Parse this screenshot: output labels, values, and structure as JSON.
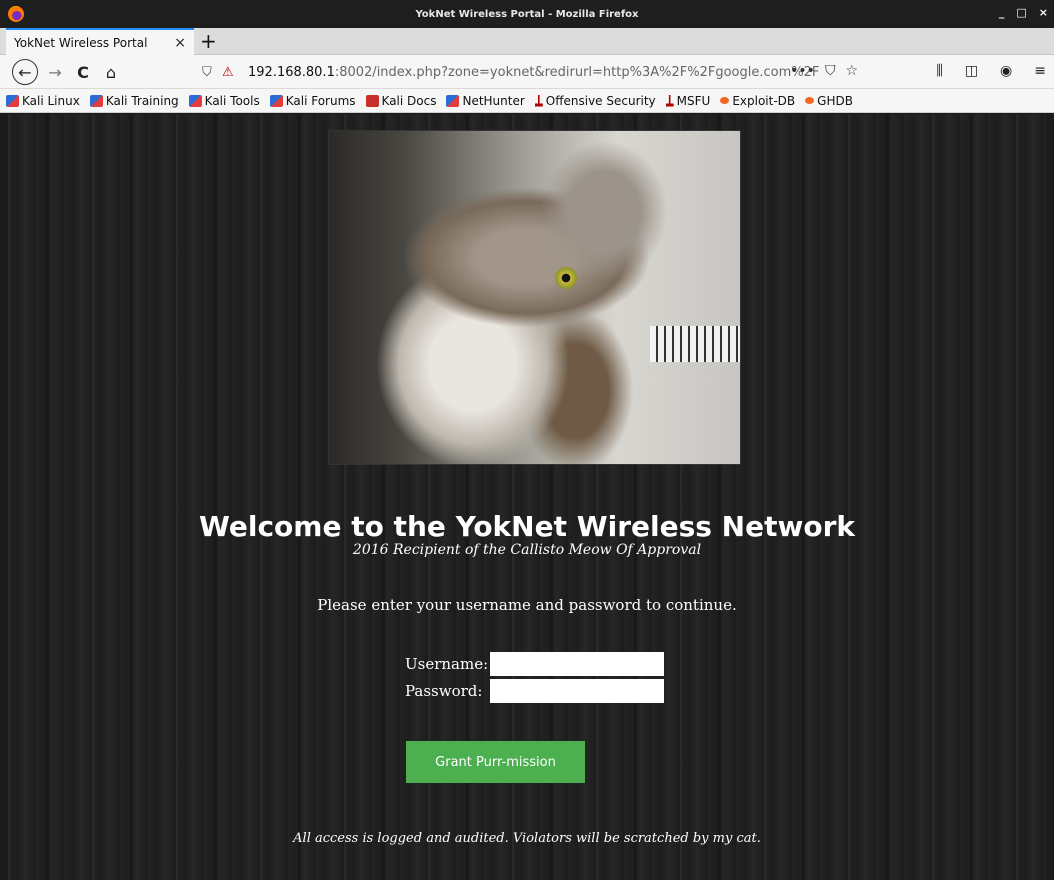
{
  "window": {
    "title": "YokNet Wireless Portal - Mozilla Firefox",
    "controls": [
      "_",
      "□",
      "×"
    ]
  },
  "tab": {
    "title": "YokNet Wireless Portal",
    "close": "×",
    "new_tab": "+"
  },
  "nav": {
    "back": "←",
    "forward": "→",
    "reload": "C",
    "home": "⌂",
    "shield": "⛉",
    "insecure": "⚠",
    "url_host": "192.168.80.1",
    "url_rest": ":8002/index.php?zone=yoknet&redirurl=http%3A%2F%2Fgoogle.com%2F",
    "page_actions": [
      "•••",
      "⛉",
      "☆"
    ],
    "toolbar_right": [
      "⫼",
      "◫",
      "◉",
      "≡"
    ]
  },
  "bookmarks": [
    {
      "label": "Kali Linux",
      "icon": "kali"
    },
    {
      "label": "Kali Training",
      "icon": "kali"
    },
    {
      "label": "Kali Tools",
      "icon": "kali"
    },
    {
      "label": "Kali Forums",
      "icon": "kali"
    },
    {
      "label": "Kali Docs",
      "icon": "red"
    },
    {
      "label": "NetHunter",
      "icon": "kali"
    },
    {
      "label": "Offensive Security",
      "icon": "ofs"
    },
    {
      "label": "MSFU",
      "icon": "ofs"
    },
    {
      "label": "Exploit-DB",
      "icon": "edb"
    },
    {
      "label": "GHDB",
      "icon": "edb"
    }
  ],
  "portal": {
    "heading": "Welcome to the YokNet Wireless Network",
    "subtitle": "2016 Recipient of the Callisto Meow Of Approval",
    "instructions": "Please enter your username and password to continue.",
    "username_label": "Username:",
    "username_value": "",
    "password_label": "Password:",
    "password_value": "",
    "submit_label": "Grant Purr-mission",
    "footer": "All access is logged and audited. Violators will be scratched by my cat."
  },
  "colors": {
    "button_green": "#4caf50",
    "tab_accent": "#1e90ff",
    "page_bg": "#202020"
  }
}
